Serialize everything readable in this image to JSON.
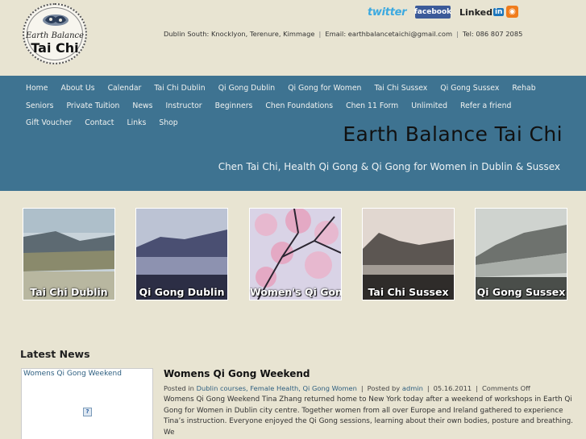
{
  "logo": {
    "line1": "Earth Balance",
    "line2": "Tai Chi"
  },
  "social": {
    "twitter": "twitter",
    "facebook": "facebook",
    "linkedin": "Linked",
    "linkedin_badge": "in",
    "rss": "◉"
  },
  "contact": {
    "location": "Dublin South: Knocklyon, Terenure, Kimmage",
    "email": "Email: earthbalancetaichi@gmail.com",
    "phone": "Tel: 086 807 2085"
  },
  "nav": {
    "items": [
      "Home",
      "About Us",
      "Calendar",
      "Tai Chi Dublin",
      "Qi Gong Dublin",
      "Qi Gong for Women",
      "Tai Chi Sussex",
      "Qi Gong Sussex",
      "Rehab",
      "Seniors",
      "Private Tuition",
      "News",
      "Instructor",
      "Beginners",
      "Chen Foundations",
      "Chen 11 Form",
      "Unlimited",
      "Refer a friend",
      "Gift Voucher",
      "Contact",
      "Links",
      "Shop"
    ]
  },
  "hero": {
    "title": "Earth Balance Tai Chi",
    "tagline": "Chen Tai Chi, Health Qi Gong & Qi Gong for Women in Dublin & Sussex"
  },
  "tiles": [
    {
      "label": "Tai Chi Dublin"
    },
    {
      "label": "Qi Gong Dublin"
    },
    {
      "label": "Women's Qi Gong"
    },
    {
      "label": "Tai Chi Sussex"
    },
    {
      "label": "Qi Gong Sussex"
    }
  ],
  "news": {
    "heading": "Latest News",
    "thumb_caption": "Womens Qi Gong Weekend",
    "post": {
      "title": "Womens Qi Gong Weekend",
      "posted_in": "Posted in",
      "categories": "Dublin courses, Female Health, Qi Gong Women",
      "posted_by": "Posted by",
      "author": "admin",
      "date": "05.16.2011",
      "comments": "Comments Off",
      "body": "Womens Qi Gong Weekend Tina Zhang returned home to New York today after a weekend of workshops in Earth Qi Gong for Women in Dublin city centre. Together women from all over Europe and Ireland gathered to experience Tina’s instruction.  Everyone enjoyed the Qi Gong sessions, learning about their own bodies, posture and breathing.  We"
    }
  },
  "colors": {
    "banner": "#3e7391",
    "background": "#e8e4d2",
    "link": "#2e5f80"
  },
  "icons": [
    "logo-yin-yang-art",
    "twitter-icon",
    "facebook-icon",
    "linkedin-icon",
    "rss-icon",
    "broken-image-icon"
  ]
}
